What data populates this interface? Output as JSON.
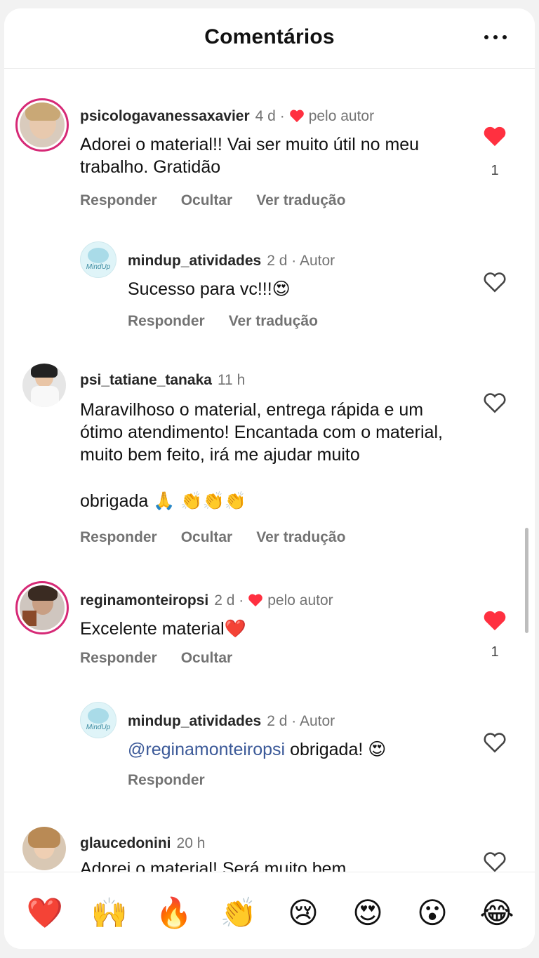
{
  "header": {
    "title": "Comentários"
  },
  "comments": [
    {
      "username": "psicologavanessaxavier",
      "time": "4 d",
      "badge": "pelo autor",
      "text": "Adorei o material!! Vai ser muito útil no meu trabalho. Gratidão",
      "actions": [
        "Responder",
        "Ocultar",
        "Ver tradução"
      ],
      "likes": "1"
    },
    {
      "username": "mindup_atividades",
      "time": "2 d",
      "badge": "Autor",
      "text": "Sucesso para vc!!!",
      "emoji": "😍",
      "actions": [
        "Responder",
        "Ver tradução"
      ],
      "avatar_text": "MindUp"
    },
    {
      "username": "psi_tatiane_tanaka",
      "time": "11 h",
      "text": "Maravilhoso o material, entrega rápida e um ótimo atendimento! Encantada com o material, muito bem feito, irá me ajudar muito",
      "text2": "obrigada",
      "emoji": "🙏 👏👏👏",
      "actions": [
        "Responder",
        "Ocultar",
        "Ver tradução"
      ]
    },
    {
      "username": "reginamonteiropsi",
      "time": "2 d",
      "badge": "pelo autor",
      "text": "Excelente material",
      "emoji": "❤️",
      "actions": [
        "Responder",
        "Ocultar"
      ],
      "likes": "1"
    },
    {
      "username": "mindup_atividades",
      "time": "2 d",
      "badge": "Autor",
      "mention": "@reginamonteiropsi",
      "text": "obrigada!",
      "emoji": "😍",
      "actions": [
        "Responder"
      ],
      "avatar_text": "MindUp"
    },
    {
      "username": "glaucedonini",
      "time": "20 h",
      "text": "Adorei o material! Será muito bem"
    }
  ],
  "emoji_bar": [
    "❤️",
    "🙌",
    "🔥",
    "👏",
    "😢",
    "😍",
    "😮",
    "😂"
  ],
  "colors": {
    "like_red": "#ff3040",
    "secondary_text": "#737373",
    "mention": "#3b5998",
    "story_ring": "#d62976"
  }
}
